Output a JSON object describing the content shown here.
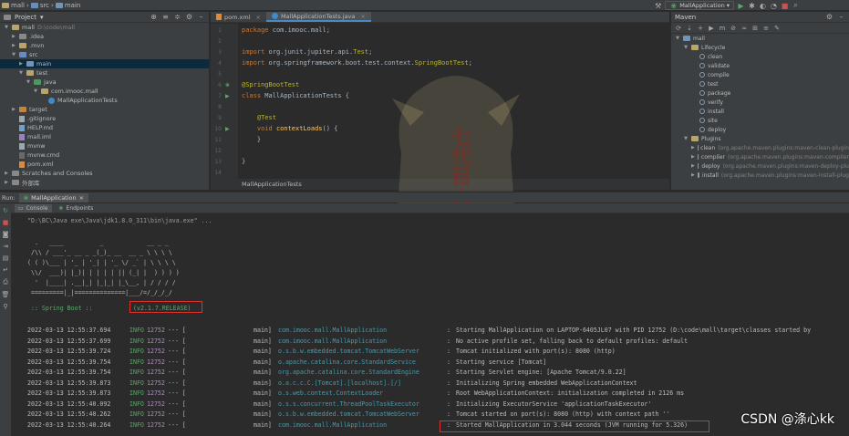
{
  "breadcrumb": [
    "mall",
    "src",
    "main"
  ],
  "run_config": {
    "label": "MallApplication"
  },
  "project_panel": {
    "title": "Project",
    "tree": [
      {
        "label": "mall",
        "extra": "D:\\code\\mall",
        "indent": 0,
        "icon": "folder",
        "state": "open"
      },
      {
        "label": ".idea",
        "indent": 1,
        "icon": "folder-grey",
        "state": "closed"
      },
      {
        "label": ".mvn",
        "indent": 1,
        "icon": "folder",
        "state": "closed"
      },
      {
        "label": "src",
        "indent": 1,
        "icon": "folder-src",
        "state": "open"
      },
      {
        "label": "main",
        "indent": 2,
        "icon": "folder-blue",
        "state": "closed",
        "selected": true
      },
      {
        "label": "test",
        "indent": 2,
        "icon": "folder",
        "state": "open"
      },
      {
        "label": "java",
        "indent": 3,
        "icon": "folder-test",
        "state": "open"
      },
      {
        "label": "com.imooc.mall",
        "indent": 4,
        "icon": "folder",
        "state": "open"
      },
      {
        "label": "MallApplicationTests",
        "indent": 5,
        "icon": "java",
        "state": "none"
      },
      {
        "label": "target",
        "indent": 1,
        "icon": "folder-orange",
        "state": "closed"
      },
      {
        "label": ".gitignore",
        "indent": 1,
        "icon": "file",
        "state": "none"
      },
      {
        "label": "HELP.md",
        "indent": 1,
        "icon": "md",
        "state": "none"
      },
      {
        "label": "mall.iml",
        "indent": 1,
        "icon": "iml",
        "state": "none"
      },
      {
        "label": "mvnw",
        "indent": 1,
        "icon": "file",
        "state": "none"
      },
      {
        "label": "mvnw.cmd",
        "indent": 1,
        "icon": "cmd",
        "state": "none"
      },
      {
        "label": "pom.xml",
        "indent": 1,
        "icon": "xml",
        "state": "none"
      },
      {
        "label": "Scratches and Consoles",
        "indent": 0,
        "icon": "folder-grey",
        "state": "closed"
      },
      {
        "label": "外部库",
        "indent": 0,
        "icon": "folder-grey",
        "state": "closed"
      }
    ]
  },
  "editor": {
    "tabs": [
      {
        "label": "pom.xml",
        "active": false
      },
      {
        "label": "MallApplicationTests.java",
        "active": true
      }
    ],
    "lines": [
      {
        "n": "1",
        "html": "<span class='kw'>package</span> com.imooc.mall;"
      },
      {
        "n": "2",
        "html": ""
      },
      {
        "n": "3",
        "html": "<span class='kw'>import</span> org.junit.jupiter.api.<span class='ann'>Test</span>;"
      },
      {
        "n": "4",
        "html": "<span class='kw'>import</span> org.springframework.boot.test.context.<span class='ann'>SpringBootTest</span>;"
      },
      {
        "n": "5",
        "html": ""
      },
      {
        "n": "6",
        "html": "<span class='ann'>@SpringBootTest</span>"
      },
      {
        "n": "7",
        "html": "<span class='kw'>class</span> MallApplicationTests {"
      },
      {
        "n": "8",
        "html": ""
      },
      {
        "n": "9",
        "html": "    <span class='ann'>@Test</span>"
      },
      {
        "n": "10",
        "html": "    <span class='kw'>void</span> <span class='fn'>contextLoads</span>() {"
      },
      {
        "n": "11",
        "html": "    }"
      },
      {
        "n": "12",
        "html": ""
      },
      {
        "n": "13",
        "html": "}"
      },
      {
        "n": "14",
        "html": ""
      }
    ],
    "breadcrumb": "MallApplicationTests"
  },
  "watermark_text": "七代目火影",
  "maven_panel": {
    "title": "Maven",
    "tree": [
      {
        "label": "mall",
        "indent": 0,
        "icon": "maven",
        "state": "open"
      },
      {
        "label": "Lifecycle",
        "indent": 1,
        "icon": "folder",
        "state": "open"
      },
      {
        "label": "clean",
        "indent": 2,
        "icon": "gear"
      },
      {
        "label": "validate",
        "indent": 2,
        "icon": "gear"
      },
      {
        "label": "compile",
        "indent": 2,
        "icon": "gear"
      },
      {
        "label": "test",
        "indent": 2,
        "icon": "gear"
      },
      {
        "label": "package",
        "indent": 2,
        "icon": "gear"
      },
      {
        "label": "verify",
        "indent": 2,
        "icon": "gear"
      },
      {
        "label": "install",
        "indent": 2,
        "icon": "gear"
      },
      {
        "label": "site",
        "indent": 2,
        "icon": "gear"
      },
      {
        "label": "deploy",
        "indent": 2,
        "icon": "gear"
      },
      {
        "label": "Plugins",
        "indent": 1,
        "icon": "folder",
        "state": "open"
      },
      {
        "label": "clean",
        "extra": "(org.apache.maven.plugins:maven-clean-plugin",
        "indent": 2,
        "icon": "plug",
        "state": "closed"
      },
      {
        "label": "compiler",
        "extra": "(org.apache.maven.plugins:maven-compiler",
        "indent": 2,
        "icon": "plug",
        "state": "closed"
      },
      {
        "label": "deploy",
        "extra": "(org.apache.maven.plugins:maven-deploy-plu",
        "indent": 2,
        "icon": "plug",
        "state": "closed"
      },
      {
        "label": "install",
        "extra": "(org.apache.maven.plugins:maven-install-plug",
        "indent": 2,
        "icon": "plug",
        "state": "closed"
      }
    ]
  },
  "run_panel": {
    "label": "Run:",
    "tab": "MallApplication",
    "subtabs": [
      "Console",
      "Endpoints"
    ],
    "command": "\"D:\\BC\\Java exe\\Java\\jdk1.8.0_311\\bin\\java.exe\" ...",
    "banner": [
      "  .   ____          _            __ _ _",
      " /\\\\ / ___'_ __ _ _(_)_ __  __ _ \\ \\ \\ \\",
      "( ( )\\___ | '_ | '_| | '_ \\/ _` | \\ \\ \\ \\",
      " \\\\/  ___)| |_)| | | | | || (_| |  ) ) ) )",
      "  '  |____| .__|_| |_|_| |_\\__, | / / / /",
      " =========|_|==============|___/=/_/_/_/"
    ],
    "spring_boot_label": " :: Spring Boot ::",
    "spring_boot_version": "(v2.1.7.RELEASE)",
    "logs": [
      {
        "ts": "2022-03-13 12:55:37.694",
        "level": "INFO",
        "pid": "12752",
        "sep": "--- [",
        "thread": "main]",
        "logger": "com.imooc.mall.MallApplication",
        "msg": "Starting MallApplication on LAPTOP-6405JL07 with PID 12752 (D:\\code\\mall\\target\\classes started by"
      },
      {
        "ts": "2022-03-13 12:55:37.699",
        "level": "INFO",
        "pid": "12752",
        "sep": "--- [",
        "thread": "main]",
        "logger": "com.imooc.mall.MallApplication",
        "msg": "No active profile set, falling back to default profiles: default"
      },
      {
        "ts": "2022-03-13 12:55:39.724",
        "level": "INFO",
        "pid": "12752",
        "sep": "--- [",
        "thread": "main]",
        "logger": "o.s.b.w.embedded.tomcat.TomcatWebServer",
        "msg": "Tomcat initialized with port(s): 8080 (http)"
      },
      {
        "ts": "2022-03-13 12:55:39.754",
        "level": "INFO",
        "pid": "12752",
        "sep": "--- [",
        "thread": "main]",
        "logger": "o.apache.catalina.core.StandardService",
        "msg": "Starting service [Tomcat]"
      },
      {
        "ts": "2022-03-13 12:55:39.754",
        "level": "INFO",
        "pid": "12752",
        "sep": "--- [",
        "thread": "main]",
        "logger": "org.apache.catalina.core.StandardEngine",
        "msg": "Starting Servlet engine: [Apache Tomcat/9.0.22]"
      },
      {
        "ts": "2022-03-13 12:55:39.873",
        "level": "INFO",
        "pid": "12752",
        "sep": "--- [",
        "thread": "main]",
        "logger": "o.a.c.c.C.[Tomcat].[localhost].[/]",
        "msg": "Initializing Spring embedded WebApplicationContext"
      },
      {
        "ts": "2022-03-13 12:55:39.873",
        "level": "INFO",
        "pid": "12752",
        "sep": "--- [",
        "thread": "main]",
        "logger": "o.s.web.context.ContextLoader",
        "msg": "Root WebApplicationContext: initialization completed in 2126 ms"
      },
      {
        "ts": "2022-03-13 12:55:40.092",
        "level": "INFO",
        "pid": "12752",
        "sep": "--- [",
        "thread": "main]",
        "logger": "o.s.s.concurrent.ThreadPoolTaskExecutor",
        "msg": "Initializing ExecutorService 'applicationTaskExecutor'"
      },
      {
        "ts": "2022-03-13 12:55:40.262",
        "level": "INFO",
        "pid": "12752",
        "sep": "--- [",
        "thread": "main]",
        "logger": "o.s.b.w.embedded.tomcat.TomcatWebServer",
        "msg": "Tomcat started on port(s): 8080 (http) with context path ''"
      },
      {
        "ts": "2022-03-13 12:55:40.264",
        "level": "INFO",
        "pid": "12752",
        "sep": "--- [",
        "thread": "main]",
        "logger": "com.imooc.mall.MallApplication",
        "msg": "Started MallApplication in 3.044 seconds (JVM running for 5.326)"
      }
    ]
  },
  "csdn_watermark": "CSDN @涤心kk",
  "colors": {
    "highlight": "#e0302b",
    "info": "#59a869",
    "pid": "#b389c5",
    "logger": "#3f9db0"
  }
}
